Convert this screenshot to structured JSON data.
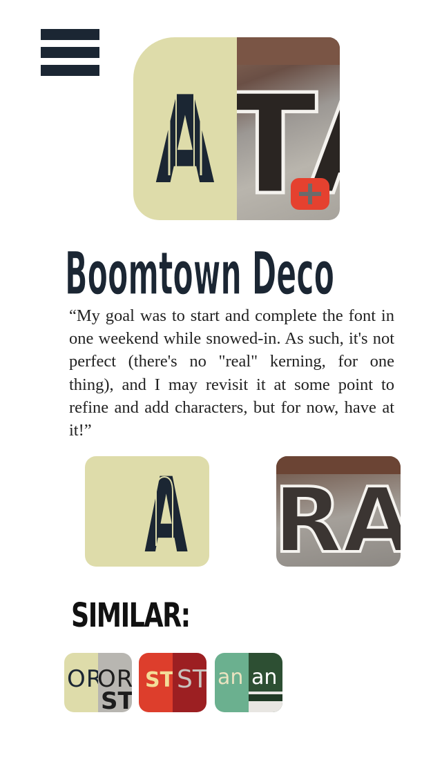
{
  "header": {
    "menu_icon": "hamburger-menu-icon"
  },
  "hero": {
    "glyph": "A",
    "photo_letters": "TA",
    "add_icon": "plus-icon",
    "colors": {
      "swatch": "#dedcaa",
      "ink": "#1b2633",
      "add": "#e5412f"
    }
  },
  "font": {
    "name": "Boomtown Deco",
    "quote": "“My goal was to start and complete the font in one weekend while snowed-in. As such, it's not perfect (there's no \"real\" kern­ing, for one thing), and I may revisit it at some point to refine and add characters, but for now, have at it!”"
  },
  "samples": {
    "glyph": "A",
    "photo_letters": "RA"
  },
  "similar": {
    "heading": "SIMILAR:",
    "items": [
      {
        "left": "OR",
        "right": "OR",
        "extra": "ST"
      },
      {
        "left": "ST",
        "right": "STO"
      },
      {
        "left": "an",
        "right": "an"
      }
    ]
  }
}
